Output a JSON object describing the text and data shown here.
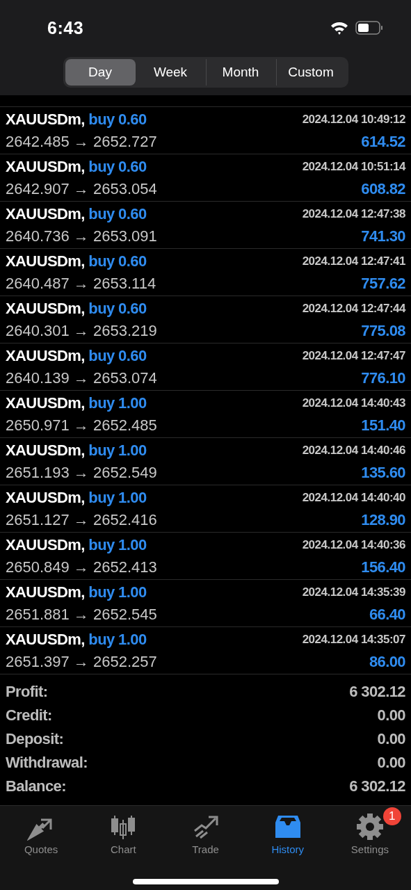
{
  "status_bar": {
    "time": "6:43"
  },
  "period_tabs": [
    {
      "label": "Day",
      "selected": true
    },
    {
      "label": "Week",
      "selected": false
    },
    {
      "label": "Month",
      "selected": false
    },
    {
      "label": "Custom",
      "selected": false
    }
  ],
  "deals": [
    {
      "symbol": "XAUUSDm,",
      "deal": "buy 0.60",
      "time": "2024.12.04 10:49:12",
      "prices": "2642.485 → 2652.727",
      "profit": "614.52"
    },
    {
      "symbol": "XAUUSDm,",
      "deal": "buy 0.60",
      "time": "2024.12.04 10:51:14",
      "prices": "2642.907 → 2653.054",
      "profit": "608.82"
    },
    {
      "symbol": "XAUUSDm,",
      "deal": "buy 0.60",
      "time": "2024.12.04 12:47:38",
      "prices": "2640.736 → 2653.091",
      "profit": "741.30"
    },
    {
      "symbol": "XAUUSDm,",
      "deal": "buy 0.60",
      "time": "2024.12.04 12:47:41",
      "prices": "2640.487 → 2653.114",
      "profit": "757.62"
    },
    {
      "symbol": "XAUUSDm,",
      "deal": "buy 0.60",
      "time": "2024.12.04 12:47:44",
      "prices": "2640.301 → 2653.219",
      "profit": "775.08"
    },
    {
      "symbol": "XAUUSDm,",
      "deal": "buy 0.60",
      "time": "2024.12.04 12:47:47",
      "prices": "2640.139 → 2653.074",
      "profit": "776.10"
    },
    {
      "symbol": "XAUUSDm,",
      "deal": "buy 1.00",
      "time": "2024.12.04 14:40:43",
      "prices": "2650.971 → 2652.485",
      "profit": "151.40"
    },
    {
      "symbol": "XAUUSDm,",
      "deal": "buy 1.00",
      "time": "2024.12.04 14:40:46",
      "prices": "2651.193 → 2652.549",
      "profit": "135.60"
    },
    {
      "symbol": "XAUUSDm,",
      "deal": "buy 1.00",
      "time": "2024.12.04 14:40:40",
      "prices": "2651.127 → 2652.416",
      "profit": "128.90"
    },
    {
      "symbol": "XAUUSDm,",
      "deal": "buy 1.00",
      "time": "2024.12.04 14:40:36",
      "prices": "2650.849 → 2652.413",
      "profit": "156.40"
    },
    {
      "symbol": "XAUUSDm,",
      "deal": "buy 1.00",
      "time": "2024.12.04 14:35:39",
      "prices": "2651.881 → 2652.545",
      "profit": "66.40"
    },
    {
      "symbol": "XAUUSDm,",
      "deal": "buy 1.00",
      "time": "2024.12.04 14:35:07",
      "prices": "2651.397 → 2652.257",
      "profit": "86.00"
    }
  ],
  "summary": [
    {
      "label": "Profit:",
      "value": "6 302.12"
    },
    {
      "label": "Credit:",
      "value": "0.00"
    },
    {
      "label": "Deposit:",
      "value": "0.00"
    },
    {
      "label": "Withdrawal:",
      "value": "0.00"
    },
    {
      "label": "Balance:",
      "value": "6 302.12"
    }
  ],
  "tab_bar": [
    {
      "kind": "quotes",
      "label": "Quotes",
      "selected": false
    },
    {
      "kind": "chart",
      "label": "Chart",
      "selected": false
    },
    {
      "kind": "trade",
      "label": "Trade",
      "selected": false
    },
    {
      "kind": "history",
      "label": "History",
      "selected": true
    },
    {
      "kind": "settings",
      "label": "Settings",
      "selected": false,
      "badge": "1"
    }
  ]
}
